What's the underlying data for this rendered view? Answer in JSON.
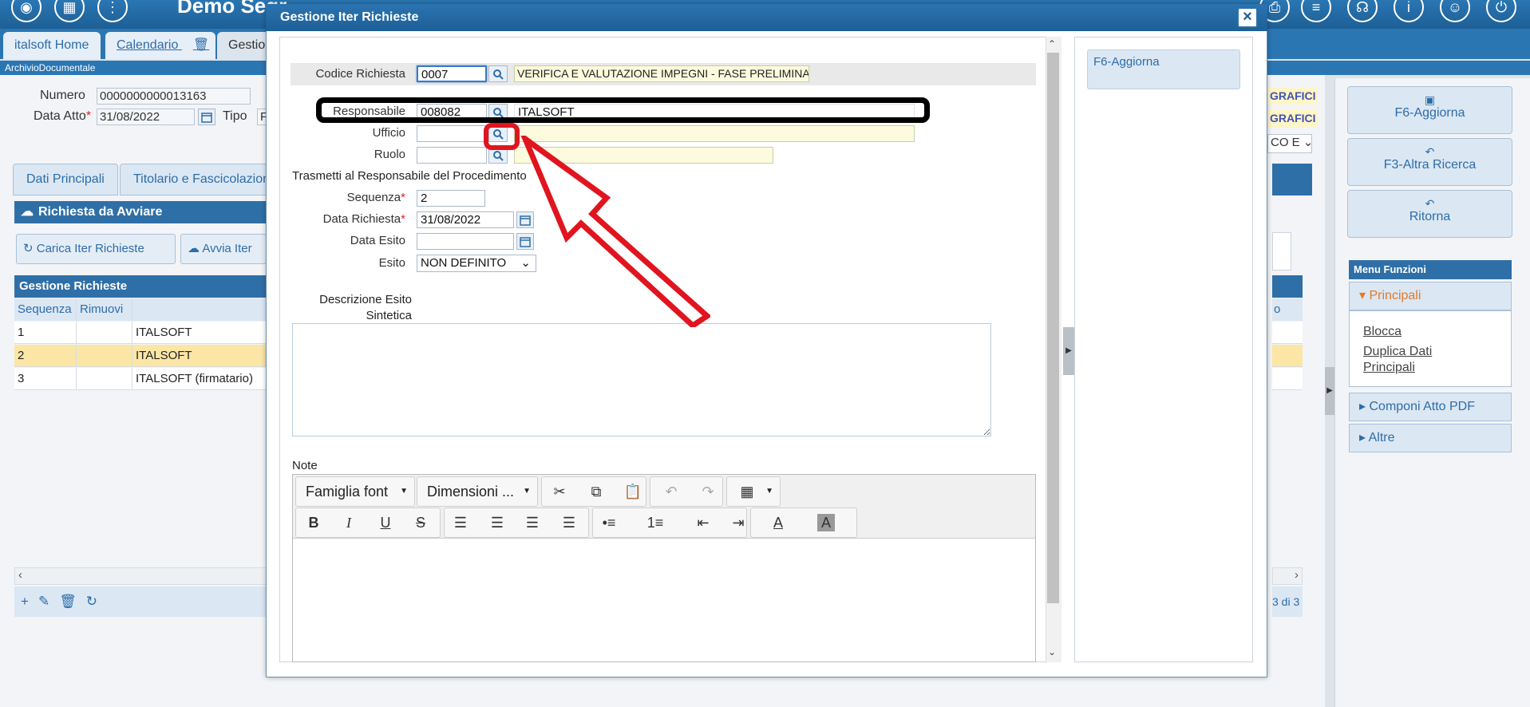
{
  "app": {
    "title": "Demo Segr"
  },
  "header": {
    "tabs": [
      {
        "label": "italsoft Home"
      },
      {
        "label": "Calendario"
      },
      {
        "label": "Gestio"
      }
    ],
    "breadcrumb": "ArchivioDocumentale"
  },
  "background_form": {
    "numero_label": "Numero",
    "numero_value": "0000000000013163",
    "data_atto_label": "Data Atto",
    "data_atto_value": "31/08/2022",
    "tipo_label": "Tipo",
    "tipo_value": "F",
    "grafici_1": "GRAFICI",
    "grafici_2": "GRAFICI",
    "select_value": "CO E",
    "subtabs": [
      {
        "label": "Dati Principali"
      },
      {
        "label": "Titolario e Fascicolazion"
      }
    ],
    "section_title": "Richiesta da Avviare",
    "buttons": [
      {
        "label": "Carica Iter Richieste"
      },
      {
        "label": "Avvia Iter"
      }
    ],
    "grid_title": "Gestione Richieste",
    "grid_headers": [
      "Sequenza",
      "Rimuovi",
      "",
      "o"
    ],
    "grid_rows": [
      {
        "seq": "1",
        "name": "ITALSOFT"
      },
      {
        "seq": "2",
        "name": "ITALSOFT"
      },
      {
        "seq": "3",
        "name": "ITALSOFT (firmatario)"
      }
    ],
    "pager": "3 di 3"
  },
  "right_panel": {
    "buttons": [
      {
        "label": "F6-Aggiorna"
      },
      {
        "label": "F3-Altra Ricerca"
      },
      {
        "label": "Ritorna"
      }
    ],
    "menu_title": "Menu Funzioni",
    "sections": [
      {
        "label": "Principali"
      },
      {
        "label": "Componi Atto PDF"
      },
      {
        "label": "Altre"
      }
    ],
    "links": [
      {
        "label": "Blocca"
      },
      {
        "label": "Duplica Dati"
      },
      {
        "label": "Principali"
      }
    ]
  },
  "modal": {
    "title": "Gestione Iter Richieste",
    "close_label": "×",
    "codice_label": "Codice Richiesta",
    "codice_value": "0007",
    "codice_desc": "VERIFICA E VALUTAZIONE IMPEGNI - FASE PRELIMINA",
    "responsabile_label": "Responsabile",
    "responsabile_value": "008082",
    "responsabile_desc": "ITALSOFT",
    "ufficio_label": "Ufficio",
    "ufficio_value": "",
    "ruolo_label": "Ruolo",
    "ruolo_value": "",
    "trasmetti_label": "Trasmetti al Responsabile del Procedimento",
    "sequenza_label": "Sequenza",
    "sequenza_value": "2",
    "data_richiesta_label": "Data Richiesta",
    "data_richiesta_value": "31/08/2022",
    "data_esito_label": "Data Esito",
    "data_esito_value": "",
    "esito_label": "Esito",
    "esito_value": "NON DEFINITO",
    "descrizione_label_1": "Descrizione Esito",
    "descrizione_label_2": "Sintetica",
    "note_label": "Note",
    "side_button": "F6-Aggiorna",
    "editor": {
      "font_family": "Famiglia font",
      "font_size": "Dimensioni ..."
    }
  },
  "colors": {
    "header_blue": "#2a76b3",
    "accent_blue": "#2d6da8",
    "selected_row": "#fbe6a6",
    "annotation_red": "#e0151f",
    "annotation_black": "#000000"
  }
}
